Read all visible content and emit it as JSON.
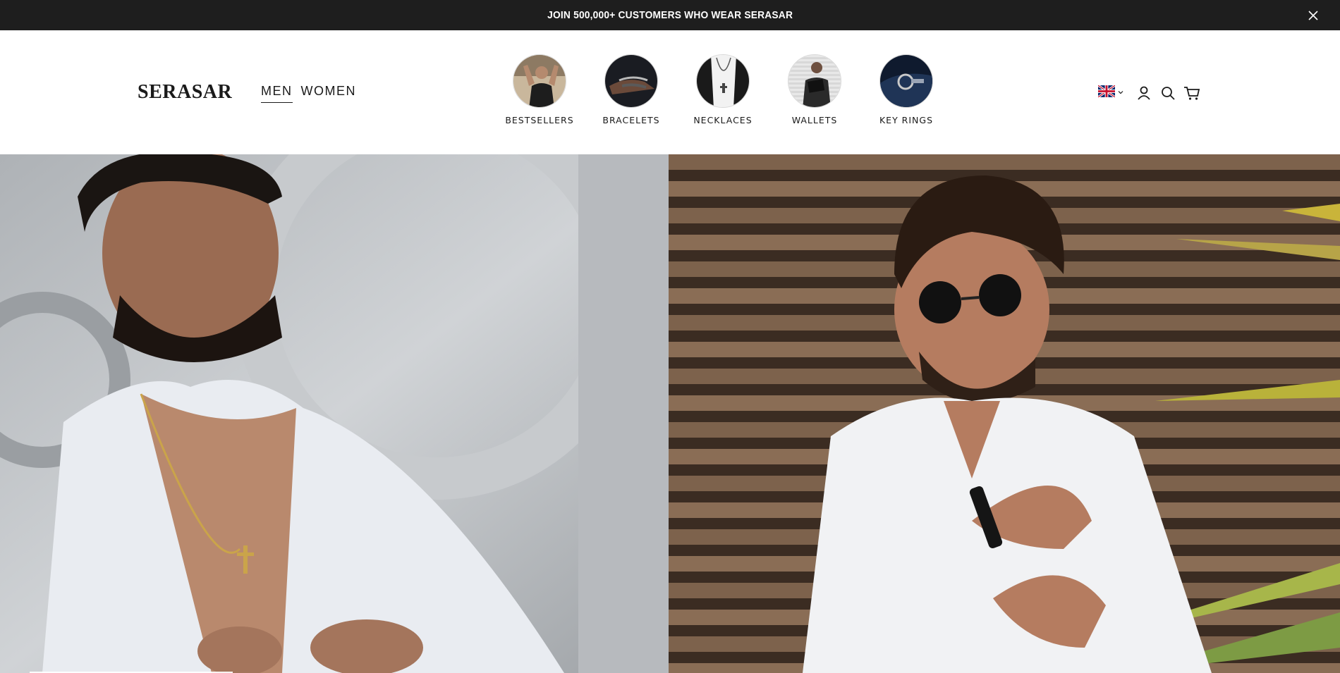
{
  "announcement": {
    "text": "JOIN 500,000+ CUSTOMERS WHO WEAR SERASAR",
    "close_icon": "close-icon"
  },
  "header": {
    "logo": "SERASAR",
    "gender_tabs": [
      {
        "label": "MEN",
        "active": true
      },
      {
        "label": "WOMEN",
        "active": false
      }
    ],
    "categories": [
      {
        "label": "BESTSELLERS"
      },
      {
        "label": "BRACELETS"
      },
      {
        "label": "NECKLACES"
      },
      {
        "label": "WALLETS"
      },
      {
        "label": "KEY RINGS"
      }
    ],
    "utilities": {
      "locale_icon": "uk-flag-icon",
      "account_icon": "user-icon",
      "search_icon": "search-icon",
      "cart_icon": "cart-icon"
    }
  },
  "colors": {
    "announcement_bg": "#1e1e1e",
    "text": "#1a1a1a",
    "background": "#ffffff"
  }
}
